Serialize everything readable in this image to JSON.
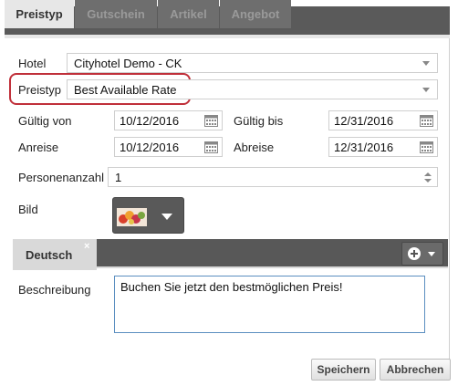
{
  "tabs": [
    {
      "label": "Preistyp",
      "active": true
    },
    {
      "label": "Gutschein",
      "active": false
    },
    {
      "label": "Artikel",
      "active": false
    },
    {
      "label": "Angebot",
      "active": false
    }
  ],
  "form": {
    "hotel_label": "Hotel",
    "hotel_value": "Cityhotel Demo - CK",
    "preistyp_label": "Preistyp",
    "preistyp_value": "Best Available Rate",
    "gueltig_von_label": "Gültig von",
    "gueltig_von_value": "10/12/2016",
    "gueltig_bis_label": "Gültig bis",
    "gueltig_bis_value": "12/31/2016",
    "anreise_label": "Anreise",
    "anreise_value": "10/12/2016",
    "abreise_label": "Abreise",
    "abreise_value": "12/31/2016",
    "personen_label": "Personenanzahl",
    "personen_value": "1",
    "bild_label": "Bild"
  },
  "language": {
    "tab_label": "Deutsch",
    "close_symbol": "×"
  },
  "description": {
    "label": "Beschreibung",
    "value": "Buchen Sie jetzt den bestmöglichen Preis!"
  },
  "buttons": {
    "save": "Speichern",
    "cancel": "Abbrechen"
  },
  "colors": {
    "highlight": "#c0303a",
    "tab_bar": "#5a5a5a",
    "active_tab": "#e7e7e7"
  }
}
